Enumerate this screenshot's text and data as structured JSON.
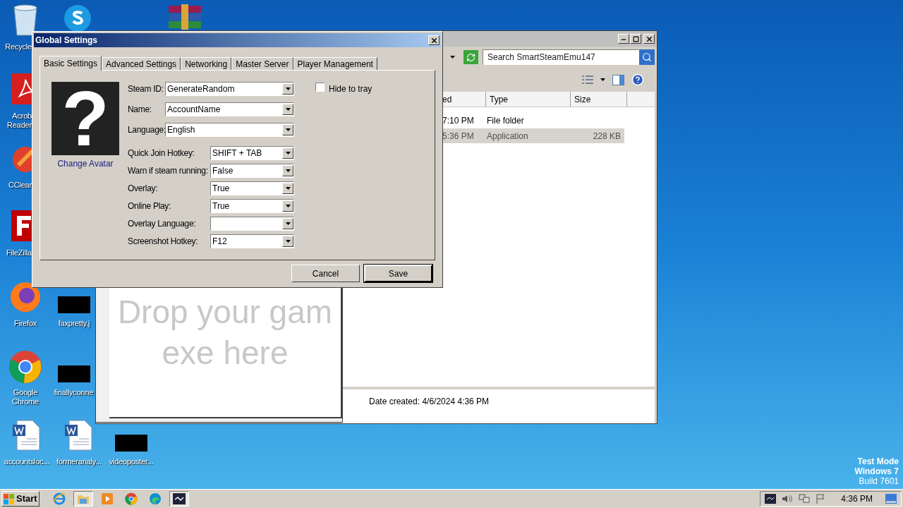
{
  "desktop": {
    "icons": [
      {
        "kind": "recycle-bin",
        "lines": [
          "Recycle"
        ]
      },
      {
        "kind": "pdf",
        "lines": [
          "Acrob",
          "Reader"
        ]
      },
      {
        "kind": "cleaner",
        "lines": [
          "CClear"
        ]
      },
      {
        "kind": "ftp",
        "lines": [
          "FileZilla"
        ]
      },
      {
        "kind": "firefox",
        "lines": [
          "Firefox"
        ]
      },
      {
        "kind": "chrome",
        "lines": [
          "Google",
          "Chrome"
        ]
      },
      {
        "kind": "word-doc",
        "lines": [
          "accountsloc..."
        ]
      },
      {
        "kind": "skype"
      },
      {
        "kind": "archive"
      },
      {
        "kind": "black-thumbnail",
        "lines": [
          "faxpretty.j"
        ]
      },
      {
        "kind": "black-thumbnail",
        "lines": [
          "finallyconne"
        ]
      },
      {
        "kind": "word-doc",
        "lines": [
          "formeranaly..."
        ]
      },
      {
        "kind": "black-thumbnail",
        "lines": [
          "videoposter..."
        ]
      }
    ],
    "system_notice": [
      "Test Mode",
      "Windows 7",
      "Build 7601"
    ]
  },
  "explorer": {
    "search_placeholder": "Search SmartSteamEmu147",
    "columns": [
      "ed",
      "Type",
      "Size"
    ],
    "rows": [
      {
        "modified": "7:10 PM",
        "type": "File folder",
        "selected": false
      },
      {
        "modified": "5:36 PM",
        "type": "Application",
        "size": "228 KB",
        "selected": true
      }
    ],
    "details": "Date created: 4/6/2024 4:36 PM"
  },
  "launcher": {
    "drop_lines": [
      "Drop your gam",
      "exe here"
    ]
  },
  "dialog": {
    "title": "Global Settings",
    "tabs": [
      {
        "label": "Basic Settings",
        "selected": true
      },
      {
        "label": "Advanced Settings",
        "selected": false
      },
      {
        "label": "Networking",
        "selected": false
      },
      {
        "label": "Master Server",
        "selected": false
      },
      {
        "label": "Player Management",
        "selected": false
      }
    ],
    "avatar": {
      "glyph": "?",
      "link": "Change Avatar"
    },
    "fields": [
      {
        "kind": "wide",
        "label": "Steam ID:",
        "value": "GenerateRandom"
      },
      {
        "kind": "wide",
        "label": "Name:",
        "value": "AccountName"
      },
      {
        "kind": "wide",
        "label": "Language:",
        "value": "English"
      },
      {
        "kind": "narrow",
        "label": "Quick Join Hotkey:",
        "value": "SHIFT + TAB"
      },
      {
        "kind": "narrow",
        "label": "Warn if steam running:",
        "value": "False"
      },
      {
        "kind": "narrow",
        "label": "Overlay:",
        "value": "True"
      },
      {
        "kind": "narrow",
        "label": "Online Play:",
        "value": "True"
      },
      {
        "kind": "narrow",
        "label": "Overlay Language:"
      },
      {
        "kind": "narrow",
        "label": "Screenshot Hotkey:",
        "value": "F12"
      }
    ],
    "checkbox": {
      "label": "Hide to tray",
      "checked": false
    },
    "buttons": [
      {
        "label": "Cancel",
        "default": false
      },
      {
        "label": "Save",
        "default": true
      }
    ]
  },
  "taskbar": {
    "start": "Start",
    "apps": [
      {
        "kind": "ie",
        "active": false
      },
      {
        "kind": "folder",
        "active": true
      },
      {
        "kind": "media",
        "active": false
      },
      {
        "kind": "chrome",
        "active": false
      },
      {
        "kind": "edge",
        "active": false
      },
      {
        "kind": "app",
        "active": true
      }
    ],
    "clock": "4:36 PM"
  }
}
